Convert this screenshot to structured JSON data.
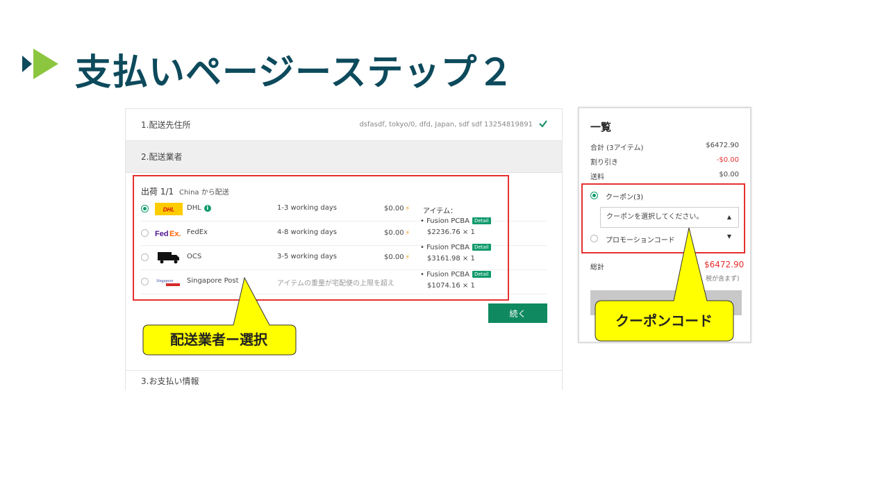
{
  "slide": {
    "title": "支払いページーステップ２"
  },
  "checkout": {
    "step1": {
      "label": "1.配送先住所",
      "address": "dsfasdf, tokyo/0, dfd, Japan, sdf sdf 13254819891"
    },
    "step2": {
      "label": "2.配送業者"
    },
    "step3": {
      "label": "3.お支払い情報"
    },
    "shipment": {
      "title": "出荷 1/1",
      "origin": "China から配送"
    },
    "carriers": [
      {
        "name": "DHL",
        "days": "1-3 working days",
        "price": "$0.00",
        "selected": true,
        "logo": "dhl-logo"
      },
      {
        "name": "FedEx",
        "days": "4-8 working days",
        "price": "$0.00",
        "selected": false,
        "logo": "fedex-logo"
      },
      {
        "name": "OCS",
        "days": "3-5 working days",
        "price": "$0.00",
        "selected": false,
        "logo": "ocs-truck-logo"
      },
      {
        "name": "Singapore Post",
        "days": "アイテムの重量が宅配便の上限を超え",
        "price": "",
        "selected": false,
        "logo": "singapore-post-logo"
      }
    ],
    "items_label": "アイテム：",
    "items": [
      {
        "name": "Fusion PCBA",
        "badge": "Detail",
        "price": "$2236.76 × 1"
      },
      {
        "name": "Fusion PCBA",
        "badge": "Detail",
        "price": "$3161.98 × 1"
      },
      {
        "name": "Fusion PCBA",
        "badge": "Detail",
        "price": "$1074.16 × 1"
      }
    ],
    "continue_label": "続く"
  },
  "summary": {
    "title": "一覧",
    "subtotal_label": "合計 (3アイテム)",
    "subtotal_value": "$6472.90",
    "discount_label": "割り引き",
    "discount_value": "-$0.00",
    "shipping_label": "送料",
    "shipping_value": "$0.00",
    "coupon_label": "クーポン(3)",
    "coupon_placeholder": "クーポンを選択してください。",
    "promo_label": "プロモーションコード",
    "total_label": "総計",
    "total_value": "$6472.90",
    "tax_note": "税が含まず)"
  },
  "callouts": {
    "carrier": "配送業者ー選択",
    "coupon": "クーポンコード"
  },
  "colors": {
    "title": "#0d4a5c",
    "accent_green": "#0f8a60",
    "highlight_red": "#e53030",
    "callout_yellow": "#ffff00",
    "arrow_green": "#8cc63f"
  }
}
